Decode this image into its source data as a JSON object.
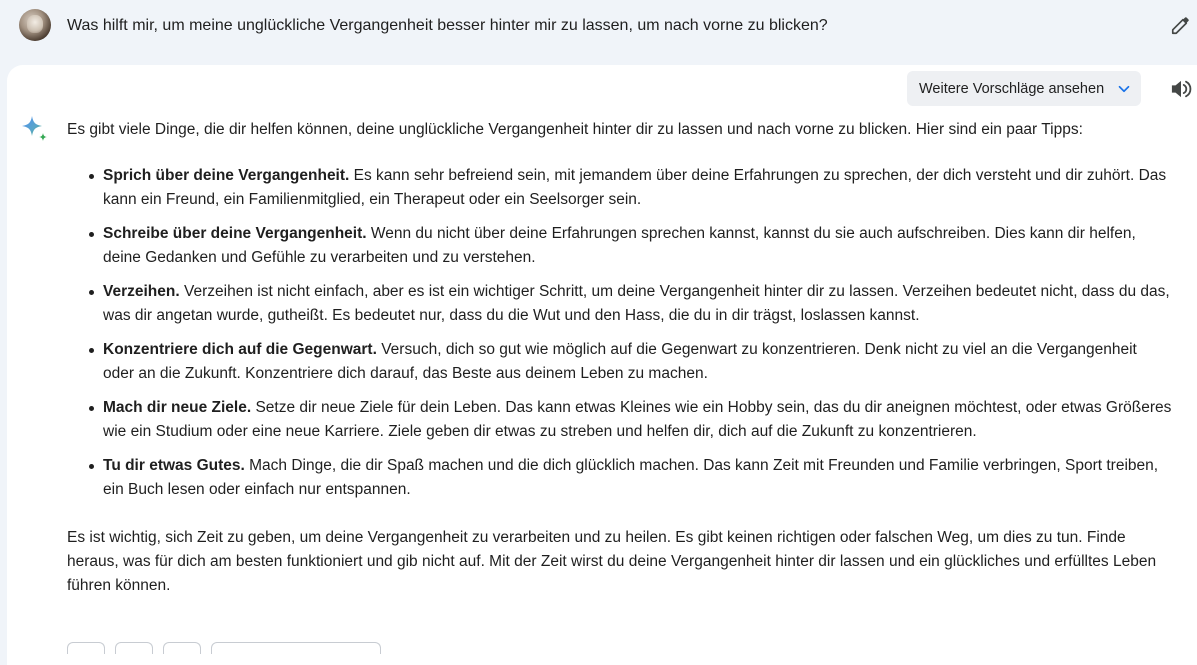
{
  "prompt": {
    "text": "Was hilft mir, um meine unglückliche Vergangenheit besser hinter mir zu lassen, um nach vorne zu blicken?"
  },
  "toolbar": {
    "drafts_label": "Weitere Vorschläge ansehen"
  },
  "response": {
    "intro": "Es gibt viele Dinge, die dir helfen können, deine unglückliche Vergangenheit hinter dir zu lassen und nach vorne zu blicken. Hier sind ein paar Tipps:",
    "tips": [
      {
        "title": "Sprich über deine Vergangenheit.",
        "body": "Es kann sehr befreiend sein, mit jemandem über deine Erfahrungen zu sprechen, der dich versteht und dir zuhört. Das kann ein Freund, ein Familienmitglied, ein Therapeut oder ein Seelsorger sein."
      },
      {
        "title": "Schreibe über deine Vergangenheit.",
        "body": "Wenn du nicht über deine Erfahrungen sprechen kannst, kannst du sie auch aufschreiben. Dies kann dir helfen, deine Gedanken und Gefühle zu verarbeiten und zu verstehen."
      },
      {
        "title": "Verzeihen.",
        "body": "Verzeihen ist nicht einfach, aber es ist ein wichtiger Schritt, um deine Vergangenheit hinter dir zu lassen. Verzeihen bedeutet nicht, dass du das, was dir angetan wurde, gutheißt. Es bedeutet nur, dass du die Wut und den Hass, die du in dir trägst, loslassen kannst."
      },
      {
        "title": "Konzentriere dich auf die Gegenwart.",
        "body": "Versuch, dich so gut wie möglich auf die Gegenwart zu konzentrieren. Denk nicht zu viel an die Vergangenheit oder an die Zukunft. Konzentriere dich darauf, das Beste aus deinem Leben zu machen."
      },
      {
        "title": "Mach dir neue Ziele.",
        "body": "Setze dir neue Ziele für dein Leben. Das kann etwas Kleines wie ein Hobby sein, das du dir aneignen möchtest, oder etwas Größeres wie ein Studium oder eine neue Karriere. Ziele geben dir etwas zu streben und helfen dir, dich auf die Zukunft zu konzentrieren."
      },
      {
        "title": "Tu dir etwas Gutes.",
        "body": "Mach Dinge, die dir Spaß machen und die dich glücklich machen. Das kann Zeit mit Freunden und Familie verbringen, Sport treiben, ein Buch lesen oder einfach nur entspannen."
      }
    ],
    "outro": "Es ist wichtig, sich Zeit zu geben, um deine Vergangenheit zu verarbeiten und zu heilen. Es gibt keinen richtigen oder falschen Weg, um dies zu tun. Finde heraus, was für dich am besten funktioniert und gib nicht auf. Mit der Zeit wirst du deine Vergangenheit hinter dir lassen und ein glückliches und erfülltes Leben führen können."
  },
  "icons": {
    "avatar": "user-avatar",
    "edit": "pencil-icon",
    "dropdown": "chevron-down-icon",
    "speaker": "speaker-icon",
    "assistant": "sparkle-icon"
  },
  "colors": {
    "page_bg": "#f0f4f9",
    "card_bg": "#ffffff",
    "text": "#1f1f1f",
    "accent_blue": "#1a73e8"
  }
}
